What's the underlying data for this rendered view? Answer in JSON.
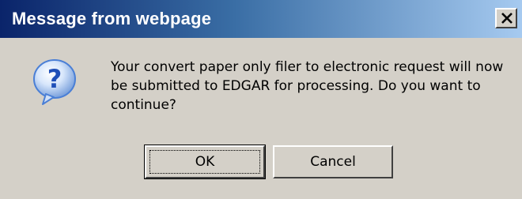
{
  "window": {
    "title": "Message from webpage",
    "close_label": "close",
    "colors": {
      "titlebar_start": "#0A246A",
      "titlebar_end": "#A6CAF0",
      "body": "#D4D0C8",
      "icon_bubble": "#4A7FD6"
    }
  },
  "dialog": {
    "icon": "question-icon",
    "message": "Your convert paper only filer to electronic request will now be submitted to EDGAR for processing.  Do you want to continue?"
  },
  "buttons": {
    "ok_label": "OK",
    "cancel_label": "Cancel"
  }
}
